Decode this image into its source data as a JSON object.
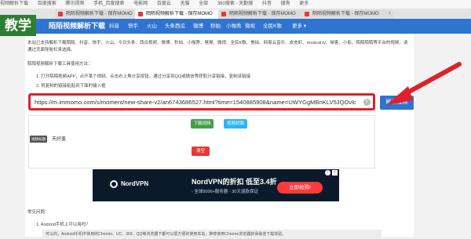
{
  "browser": {
    "bookmarks": [
      "视频解析下载",
      "百度搜索",
      "",
      "腾讯视频",
      "手机_百度搜索",
      "电影网",
      "百度云",
      "天猫",
      "全部",
      "360搜索 - 天勤搜",
      "抖音",
      "搜狗",
      "更多"
    ],
    "tabs": [
      {
        "label": "陌陌视频解析下载 - 保存MOMO",
        "active": false
      },
      {
        "label": "陌陌视频解析下载 - 保存MOMO",
        "active": true
      },
      {
        "label": "陌陌视频解析下载 - 保存MOMO",
        "active": false
      },
      {
        "label": "陌陌视频解析下载 - 保存MOMO",
        "active": false
      }
    ]
  },
  "badge": {
    "label": "教学"
  },
  "header": {
    "logo": "陌陌视频解析下载",
    "nav": [
      "抖音",
      "快手",
      "火山",
      "头条西瓜",
      "微博",
      "秒拍",
      "小咖秀",
      "微视",
      "全民K歌",
      "更多 ▾"
    ]
  },
  "main": {
    "intro": "本站已支持解析下载陌陌、抖音、快手、火山、今日头条、西瓜视频、微博、秒拍、小咖秀、晃晃、微视、全民K歌、美拍、网易云音乐、皮皮虾、musical.ly、映客、小影、陌陌陌陌等平台的视频，请通过页面导航栏来选择。",
    "howto_title": "陌陌视频解析下载工具使用方法：",
    "steps": [
      "1. 打开陌陌视频APP，点开某个视频，点击右上角分享按钮，通过分享到QQ或微信等获取分享链接，复制该链接",
      "2. 将复制的链接粘贴到下面的输入框"
    ],
    "url_value": "https://m.immomo.com/s/moment/new-share-v2/an6743686527.html?time=1540885908&name=UWYGgMBnKLV5JQOvlc",
    "parse_button": "解析视频",
    "download_video": "下载视频",
    "download_cover": "视频封面",
    "title_tag": "视频标题",
    "title_text": "天好盖",
    "clear_button": "清空"
  },
  "ad": {
    "brand": "NordVPN",
    "headline": "NordVPN的折扣 低至3.4折",
    "sub": "- 全球5000+服务器 - 30天退款保证",
    "cta": "立即抢购!"
  },
  "faq": {
    "title": "常见问题：",
    "q1": "1. Android手机上可以用吗？",
    "a1": "可以的，Android手机中常用的Chrome、UC、360、QQ等浏览器下都可以很方便的使用本站，推荐使用Chrome浏览器获得最佳下载体验。"
  },
  "colors": {
    "nav": "#2f74d0",
    "highlight": "#e0202a",
    "badge": "#2e7d32"
  }
}
